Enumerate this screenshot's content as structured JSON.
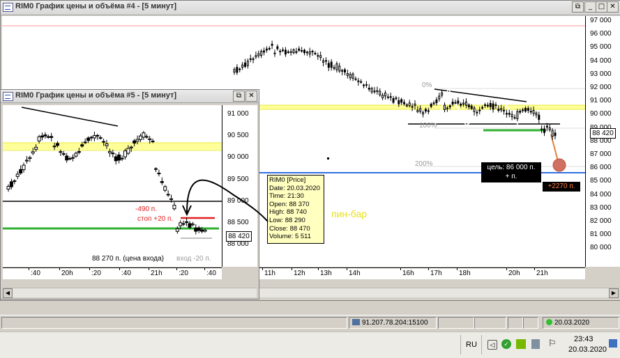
{
  "window_main": {
    "title": "RIM0 График цены и объёма #4 - [5 минут]",
    "price_labels": [
      "97 000",
      "96 000",
      "95 000",
      "94 000",
      "93 000",
      "92 000",
      "91 000",
      "90 000",
      "89 000",
      "88 000",
      "87 000",
      "86 000",
      "85 000",
      "84 000",
      "83 000",
      "82 000",
      "81 000",
      "80 000"
    ],
    "current_price": "88 420",
    "time_labels": [
      "11h",
      "12h",
      "13h",
      "14h",
      "16h",
      "17h",
      "18h",
      "20h",
      "21h"
    ],
    "fib_labels": {
      "f0": "0%",
      "f100": "100%",
      "f200": "200%"
    },
    "target_box": {
      "line1": "цель: 86 000 п.",
      "line2": "+ п."
    },
    "profit_box": "+2270 п.",
    "pin_bar_label": "пин-бар",
    "tooltip": {
      "title": "RIM0 [Price]",
      "date": "Date: 20.03.2020",
      "time": "Time: 21:30",
      "open": "Open:  88 370",
      "high": "High:   88 740",
      "low": "Low:    88 290",
      "close": "Close: 88 470",
      "volume": "Volume: 5 511"
    }
  },
  "window_small": {
    "title": "RIM0 График цены и объёма #5 - [5 минут]",
    "price_labels": [
      "91 000",
      "90 500",
      "90 000",
      "89 500",
      "89 000",
      "88 500",
      "88 000"
    ],
    "current_price": "88 420",
    "time_labels": [
      ":40",
      "20h",
      ":20",
      ":40",
      "21h",
      ":20",
      ":40"
    ],
    "stop_label": "-490 п.",
    "stop_label2": "стоп +20 п.",
    "entry_label": "88 270 п. (цена входа)",
    "entry_label2": "вход -20 п."
  },
  "title_buttons": {
    "restore": "⧉",
    "minimize": "_",
    "maximize": "□",
    "close": "✕"
  },
  "statusbar": {
    "connection": "91.207.78.204:15100",
    "date": "20.03.2020"
  },
  "taskbar": {
    "lang": "RU",
    "time": "23:43",
    "date": "20.03.2020"
  },
  "colors": {
    "yellow_line": "#f0f080",
    "green_line": "#30b030",
    "blue_line": "#3070e0",
    "target_orange": "#e08040",
    "pink_line": "#ff9090"
  }
}
